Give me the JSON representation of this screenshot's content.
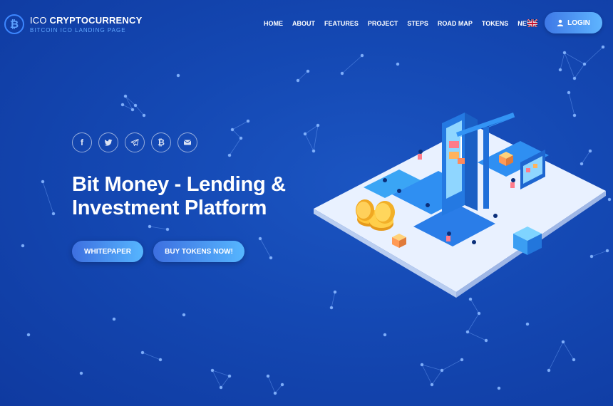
{
  "brand": {
    "title_light": "ICO",
    "title_bold": "CRYPTOCURRENCY",
    "subtitle": "BITCOIN ICO LANDING PAGE",
    "badge": "₿"
  },
  "nav": {
    "items": [
      {
        "label": "HOME"
      },
      {
        "label": "ABOUT"
      },
      {
        "label": "FEATURES"
      },
      {
        "label": "PROJECT"
      },
      {
        "label": "STEPS"
      },
      {
        "label": "ROAD MAP"
      },
      {
        "label": "TOKENS"
      },
      {
        "label": "NEWS"
      }
    ],
    "language_icon": "uk-flag-icon",
    "login_label": "LOGIN"
  },
  "social": [
    {
      "icon": "facebook-icon",
      "glyph": "f"
    },
    {
      "icon": "twitter-icon"
    },
    {
      "icon": "telegram-icon"
    },
    {
      "icon": "bitcoin-icon",
      "glyph": "₿"
    },
    {
      "icon": "email-icon"
    }
  ],
  "hero": {
    "title_line1": "Bit Money - Lending &",
    "title_line2": "Investment Platform",
    "whitepaper_label": "WHITEPAPER",
    "buy_label": "BUY TOKENS NOW!"
  },
  "colors": {
    "background": "#1448b3",
    "accent_start": "#3d6fe0",
    "accent_end": "#56b6ff"
  }
}
